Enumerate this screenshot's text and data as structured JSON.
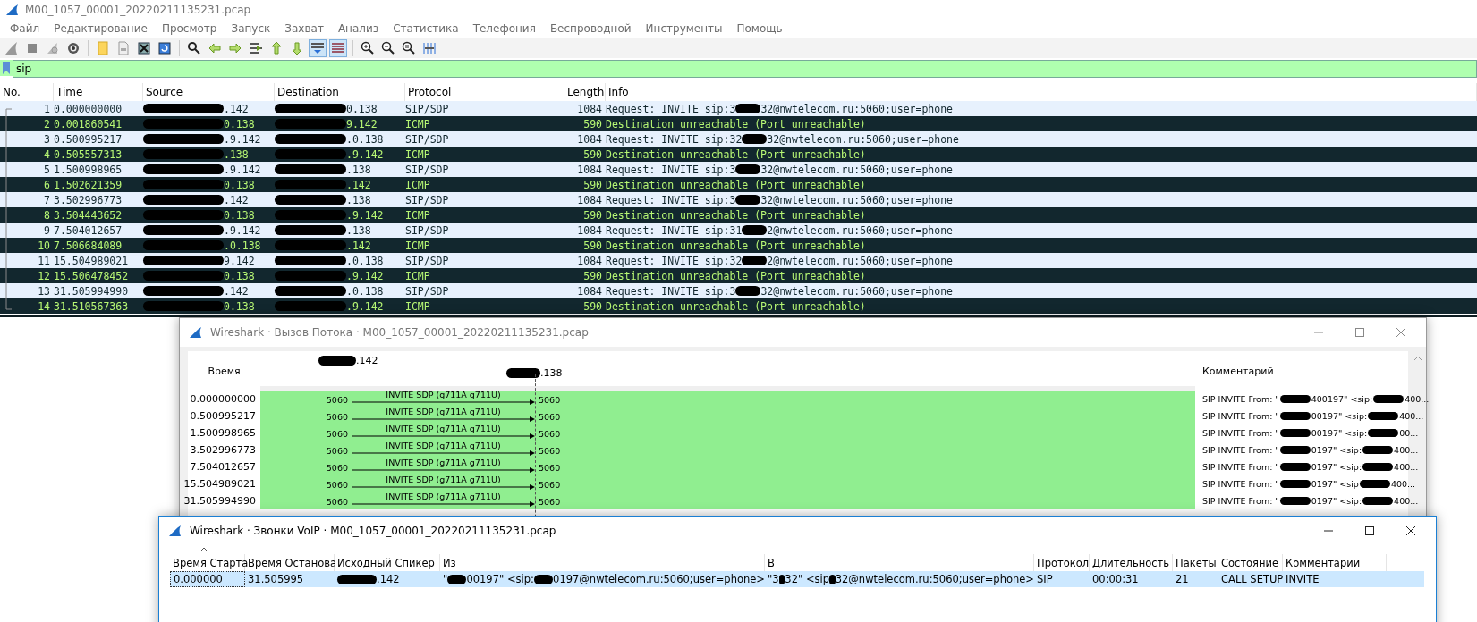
{
  "main_window": {
    "title": "M00_1057_00001_20220211135231.pcap",
    "active": false,
    "menu": [
      "Файл",
      "Редактирование",
      "Просмотр",
      "Запуск",
      "Захват",
      "Анализ",
      "Статистика",
      "Телефония",
      "Беспроводной",
      "Инструменты",
      "Помощь"
    ],
    "toolbar": [
      {
        "kind": "shark",
        "on": false
      },
      {
        "kind": "stop",
        "on": false
      },
      {
        "kind": "restart",
        "on": false
      },
      {
        "kind": "gear",
        "on": false
      },
      {
        "kind": "sep"
      },
      {
        "kind": "folder",
        "on": false
      },
      {
        "kind": "file",
        "on": false
      },
      {
        "kind": "closefile",
        "on": false
      },
      {
        "kind": "reload",
        "on": false
      },
      {
        "kind": "sep"
      },
      {
        "kind": "search",
        "on": false
      },
      {
        "kind": "back",
        "on": false
      },
      {
        "kind": "forward",
        "on": false
      },
      {
        "kind": "goto",
        "on": false
      },
      {
        "kind": "first",
        "on": false
      },
      {
        "kind": "last",
        "on": false
      },
      {
        "kind": "autoscroll",
        "on": true
      },
      {
        "kind": "colorize",
        "on": true
      },
      {
        "kind": "sep"
      },
      {
        "kind": "zoomin",
        "on": false
      },
      {
        "kind": "zoomout",
        "on": false
      },
      {
        "kind": "zoomreset",
        "on": false
      },
      {
        "kind": "resize",
        "on": false
      }
    ],
    "filter": {
      "value": "sip"
    },
    "packets": {
      "columns": [
        "No.",
        "Time",
        "Source",
        "Destination",
        "Protocol",
        "Length",
        "Info"
      ],
      "rows": [
        {
          "no": "1",
          "time": "0.000000000",
          "source": ".142",
          "destination": "0.138",
          "protocol": "SIP/SDP",
          "length": "1084",
          "info": [
            "Request: INVITE sip:3",
            "32@nwtelecom.ru:5060;user=phone"
          ],
          "kind": "sip"
        },
        {
          "no": "2",
          "time": "0.001860541",
          "source": "0.138",
          "destination": "9.142",
          "protocol": "ICMP",
          "length": "590",
          "info": [
            "Destination unreachable (Port unreachable)"
          ],
          "kind": "icmp"
        },
        {
          "no": "3",
          "time": "0.500995217",
          "source": ".9.142",
          "destination": ".0.138",
          "protocol": "SIP/SDP",
          "length": "1084",
          "info": [
            "Request: INVITE sip:32",
            "32@nwtelecom.ru:5060;user=phone"
          ],
          "kind": "sip"
        },
        {
          "no": "4",
          "time": "0.505557313",
          "source": ".138",
          "destination": ".9.142",
          "protocol": "ICMP",
          "length": "590",
          "info": [
            "Destination unreachable (Port unreachable)"
          ],
          "kind": "icmp"
        },
        {
          "no": "5",
          "time": "1.500998965",
          "source": ".9.142",
          "destination": ".138",
          "protocol": "SIP/SDP",
          "length": "1084",
          "info": [
            "Request: INVITE sip:3",
            "32@nwtelecom.ru:5060;user=phone"
          ],
          "kind": "sip"
        },
        {
          "no": "6",
          "time": "1.502621359",
          "source": "0.138",
          "destination": ".142",
          "protocol": "ICMP",
          "length": "590",
          "info": [
            "Destination unreachable (Port unreachable)"
          ],
          "kind": "icmp"
        },
        {
          "no": "7",
          "time": "3.502996773",
          "source": ".142",
          "destination": ".138",
          "protocol": "SIP/SDP",
          "length": "1084",
          "info": [
            "Request: INVITE sip:3",
            "32@nwtelecom.ru:5060;user=phone"
          ],
          "kind": "sip"
        },
        {
          "no": "8",
          "time": "3.504443652",
          "source": "0.138",
          "destination": ".9.142",
          "protocol": "ICMP",
          "length": "590",
          "info": [
            "Destination unreachable (Port unreachable)"
          ],
          "kind": "icmp"
        },
        {
          "no": "9",
          "time": "7.504012657",
          "source": ".9.142",
          "destination": ".138",
          "protocol": "SIP/SDP",
          "length": "1084",
          "info": [
            "Request: INVITE sip:31",
            "2@nwtelecom.ru:5060;user=phone"
          ],
          "kind": "sip"
        },
        {
          "no": "10",
          "time": "7.506684089",
          "source": ".0.138",
          "destination": ".142",
          "protocol": "ICMP",
          "length": "590",
          "info": [
            "Destination unreachable (Port unreachable)"
          ],
          "kind": "icmp"
        },
        {
          "no": "11",
          "time": "15.504989021",
          "source": "9.142",
          "destination": ".0.138",
          "protocol": "SIP/SDP",
          "length": "1084",
          "info": [
            "Request: INVITE sip:32",
            "2@nwtelecom.ru:5060;user=phone"
          ],
          "kind": "sip"
        },
        {
          "no": "12",
          "time": "15.506478452",
          "source": "0.138",
          "destination": ".9.142",
          "protocol": "ICMP",
          "length": "590",
          "info": [
            "Destination unreachable (Port unreachable)"
          ],
          "kind": "icmp"
        },
        {
          "no": "13",
          "time": "31.505994990",
          "source": ".142",
          "destination": ".0.138",
          "protocol": "SIP/SDP",
          "length": "1084",
          "info": [
            "Request: INVITE sip:3",
            "32@nwtelecom.ru:5060;user=phone"
          ],
          "kind": "sip"
        },
        {
          "no": "14",
          "time": "31.510567363",
          "source": "0.138",
          "destination": ".9.142",
          "protocol": "ICMP",
          "length": "590",
          "info": [
            "Destination unreachable (Port unreachable)"
          ],
          "kind": "icmp"
        }
      ]
    }
  },
  "flow_window": {
    "title": "Wireshark · Вызов Потока · M00_1057_00001_20220211135231.pcap",
    "active": false,
    "time_header": "Время",
    "comment_header": "Комментарий",
    "nodes": [
      ".142",
      ".138"
    ],
    "messages": [
      {
        "time": "0.000000000",
        "src_port": "5060",
        "label": "INVITE SDP (g711A g711U)",
        "dst_port": "5060",
        "comment": [
          "SIP INVITE From: \"",
          "400197\" <sip:",
          "400..."
        ]
      },
      {
        "time": "0.500995217",
        "src_port": "5060",
        "label": "INVITE SDP (g711A g711U)",
        "dst_port": "5060",
        "comment": [
          "SIP INVITE From: \"",
          "00197\" <sip:",
          "400..."
        ]
      },
      {
        "time": "1.500998965",
        "src_port": "5060",
        "label": "INVITE SDP (g711A g711U)",
        "dst_port": "5060",
        "comment": [
          "SIP INVITE From: \"",
          "00197\" <sip:",
          "00..."
        ]
      },
      {
        "time": "3.502996773",
        "src_port": "5060",
        "label": "INVITE SDP (g711A g711U)",
        "dst_port": "5060",
        "comment": [
          "SIP INVITE From: \"",
          "0197\" <sip:",
          "400..."
        ]
      },
      {
        "time": "7.504012657",
        "src_port": "5060",
        "label": "INVITE SDP (g711A g711U)",
        "dst_port": "5060",
        "comment": [
          "SIP INVITE From: \"",
          "0197\" <sip:",
          "400..."
        ]
      },
      {
        "time": "15.504989021",
        "src_port": "5060",
        "label": "INVITE SDP (g711A g711U)",
        "dst_port": "5060",
        "comment": [
          "SIP INVITE From: \"",
          "0197\" <sip",
          "400..."
        ]
      },
      {
        "time": "31.505994990",
        "src_port": "5060",
        "label": "INVITE SDP (g711A g711U)",
        "dst_port": "5060",
        "comment": [
          "SIP INVITE From: \"",
          "0197\" <sip:",
          "400..."
        ]
      }
    ]
  },
  "voip_window": {
    "title": "Wireshark · Звонки VoIP · M00_1057_00001_20220211135231.pcap",
    "active": true,
    "columns": [
      "Время Старта",
      "Время Останова",
      "Исходный Спикер",
      "Из",
      "В",
      "Протокол",
      "Длительность",
      "Пакеты",
      "Состояние",
      "Комментарии"
    ],
    "rows": [
      {
        "selected": true,
        "start": "0.000000",
        "stop": "31.505995",
        "speaker": [
          ".142"
        ],
        "from": [
          "\"",
          "00197\" <sip:",
          "0197@nwtelecom.ru:5060;user=phone>"
        ],
        "to": [
          "\"3",
          "32\" <sip",
          "32@nwtelecom.ru:5060;user=phone>"
        ],
        "protocol": "SIP",
        "duration": "00:00:31",
        "packets": "21",
        "state": "CALL SETUP",
        "comment": "INVITE"
      }
    ]
  }
}
